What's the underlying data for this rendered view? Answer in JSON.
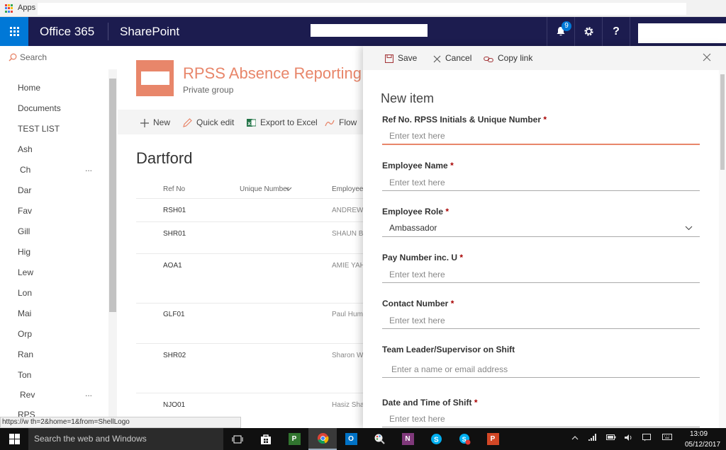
{
  "browser": {
    "apps_label": "Apps"
  },
  "suite_bar": {
    "brand": "Office 365",
    "app_name": "SharePoint",
    "notification_count": "9",
    "settings_icon": "gear-icon",
    "help_label": "?",
    "accent": "#0078d7",
    "background": "#1c1c4f"
  },
  "left_nav": {
    "search_placeholder": "Search",
    "items": [
      "Home",
      "Documents",
      "TEST LIST",
      "Ash",
      "Ch",
      "Dar",
      "Fav",
      "Gill",
      "Hig",
      "Lew",
      "Lon",
      "Mai",
      "Orp",
      "Ran",
      "Ton",
      "Rev",
      "RPS"
    ],
    "ellipsis": "..."
  },
  "site": {
    "title": "RPSS Absence Reporting",
    "subtitle": "Private group",
    "logo_color": "#e8866a"
  },
  "command_bar": {
    "new": "New",
    "quick_edit": "Quick edit",
    "export": "Export to Excel",
    "flow": "Flow"
  },
  "list": {
    "view_title": "Dartford",
    "columns": [
      "Ref No",
      "Unique Number",
      "Employee"
    ],
    "rows": [
      {
        "ref": "RSH01",
        "employee": "ANDREW"
      },
      {
        "ref": "SHR01",
        "employee": "SHAUN BL"
      },
      {
        "ref": "AOA1",
        "employee": "AMIE YAH"
      },
      {
        "ref": "GLF01",
        "employee": "Paul Hum"
      },
      {
        "ref": "SHR02",
        "employee": "Sharon W"
      },
      {
        "ref": "NJO01",
        "employee": "Hasiz Shaz"
      }
    ]
  },
  "panel": {
    "save": "Save",
    "cancel": "Cancel",
    "copy_link": "Copy link",
    "heading": "New item",
    "required_marker": "*",
    "fields": {
      "ref_no": {
        "label": "Ref No. RPSS Initials & Unique Number",
        "placeholder": "Enter text here"
      },
      "employee_name": {
        "label": "Employee Name",
        "placeholder": "Enter text here"
      },
      "employee_role": {
        "label": "Employee Role",
        "value": "Ambassador"
      },
      "pay_number": {
        "label": "Pay Number inc. U",
        "placeholder": "Enter text here"
      },
      "contact_number": {
        "label": "Contact Number",
        "placeholder": "Enter text here"
      },
      "team_leader": {
        "label": "Team Leader/Supervisor on Shift",
        "placeholder": "Enter a name or email address"
      },
      "date_time": {
        "label": "Date and Time of Shift",
        "placeholder": "Enter text here"
      }
    },
    "focus_color": "#e8866a"
  },
  "status_bar": {
    "url": "https://w                     th=2&home=1&from=ShellLogo"
  },
  "taskbar": {
    "search_placeholder": "Search the web and Windows",
    "time": "13:09",
    "date": "05/12/2017"
  }
}
